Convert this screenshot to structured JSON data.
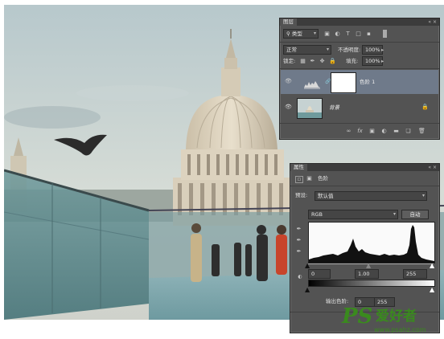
{
  "layers_panel": {
    "tab_label": "图层",
    "filter_kind": "类型",
    "blend_mode": "正常",
    "opacity_label": "不透明度:",
    "opacity_value": "100%",
    "lock_label": "锁定:",
    "fill_label": "填充:",
    "fill_value": "100%",
    "layers": [
      {
        "name": "色阶 1",
        "selected": true,
        "type": "adjustment"
      },
      {
        "name": "背景",
        "selected": false,
        "type": "image",
        "locked": true
      }
    ],
    "footer_icons": [
      "link-icon",
      "fx-icon",
      "mask-icon",
      "adjustment-icon",
      "folder-icon",
      "new-layer-icon",
      "trash-icon"
    ]
  },
  "properties_panel": {
    "tab_label": "属性",
    "adjustment_title": "色阶",
    "preset_label": "预设:",
    "preset_value": "默认值",
    "channel_value": "RGB",
    "auto_button": "自动",
    "input_black": "0",
    "input_gamma": "1.00",
    "input_white": "255",
    "output_label": "输出色阶:",
    "output_black": "0",
    "output_white": "255"
  },
  "watermark": {
    "brand_large": "PS",
    "brand_cn": "爱好者",
    "url": "www.psahz.com"
  },
  "colors": {
    "panel_bg": "#535353",
    "selected_row": "#6f7a8a",
    "watermark_green": "#3a8a1e"
  }
}
